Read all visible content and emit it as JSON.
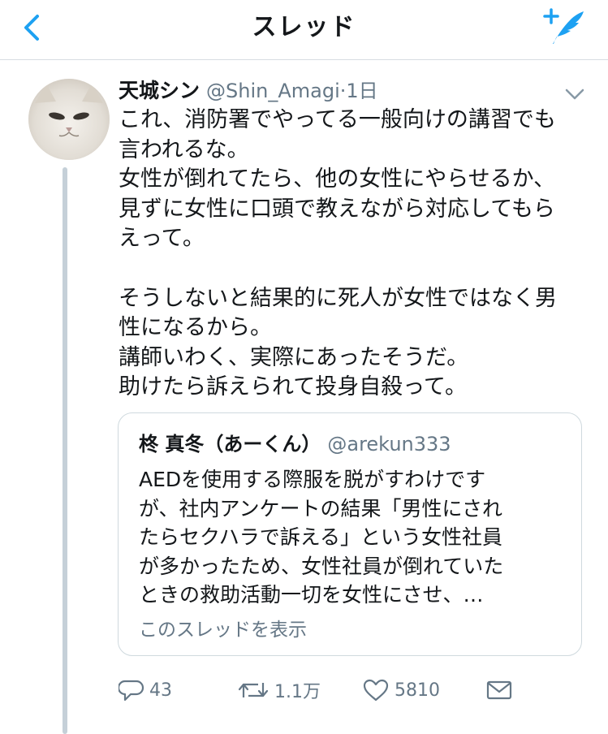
{
  "header": {
    "title": "スレッド",
    "back_icon": "chevron-left-icon",
    "compose_icon": "compose-tweet-icon",
    "accent_color": "#1da1f2"
  },
  "tweet": {
    "author_name": "天城シン",
    "handle": "@Shin_Amagi",
    "separator": "·",
    "time": "1日",
    "body_lines": [
      "これ、消防署でやってる一般向けの講習でも",
      "言われるな。",
      "女性が倒れてたら、他の女性にやらせるか、",
      "見ずに女性に口頭で教えながら対応してもら",
      "えって。",
      "",
      "そうしないと結果的に死人が女性ではなく男",
      "性になるから。",
      "講師いわく、実際にあったそうだ。",
      "助けたら訴えられて投身自殺って。"
    ]
  },
  "quote": {
    "author_name": "柊 真冬（あーくん）",
    "handle": "@arekun333",
    "body_lines": [
      "AEDを使用する際服を脱がすわけです",
      "が、社内アンケートの結果「男性にされ",
      "たらセクハラで訴える」という女性社員",
      "が多かったため、女性社員が倒れていた",
      "ときの救助活動一切を女性にさせ、…"
    ],
    "show_thread": "このスレッドを表示"
  },
  "actions": {
    "reply_count": "43",
    "retweet_count": "1.1万",
    "like_count": "5810",
    "icons": [
      "reply-icon",
      "retweet-icon",
      "like-icon",
      "share-icon"
    ]
  }
}
